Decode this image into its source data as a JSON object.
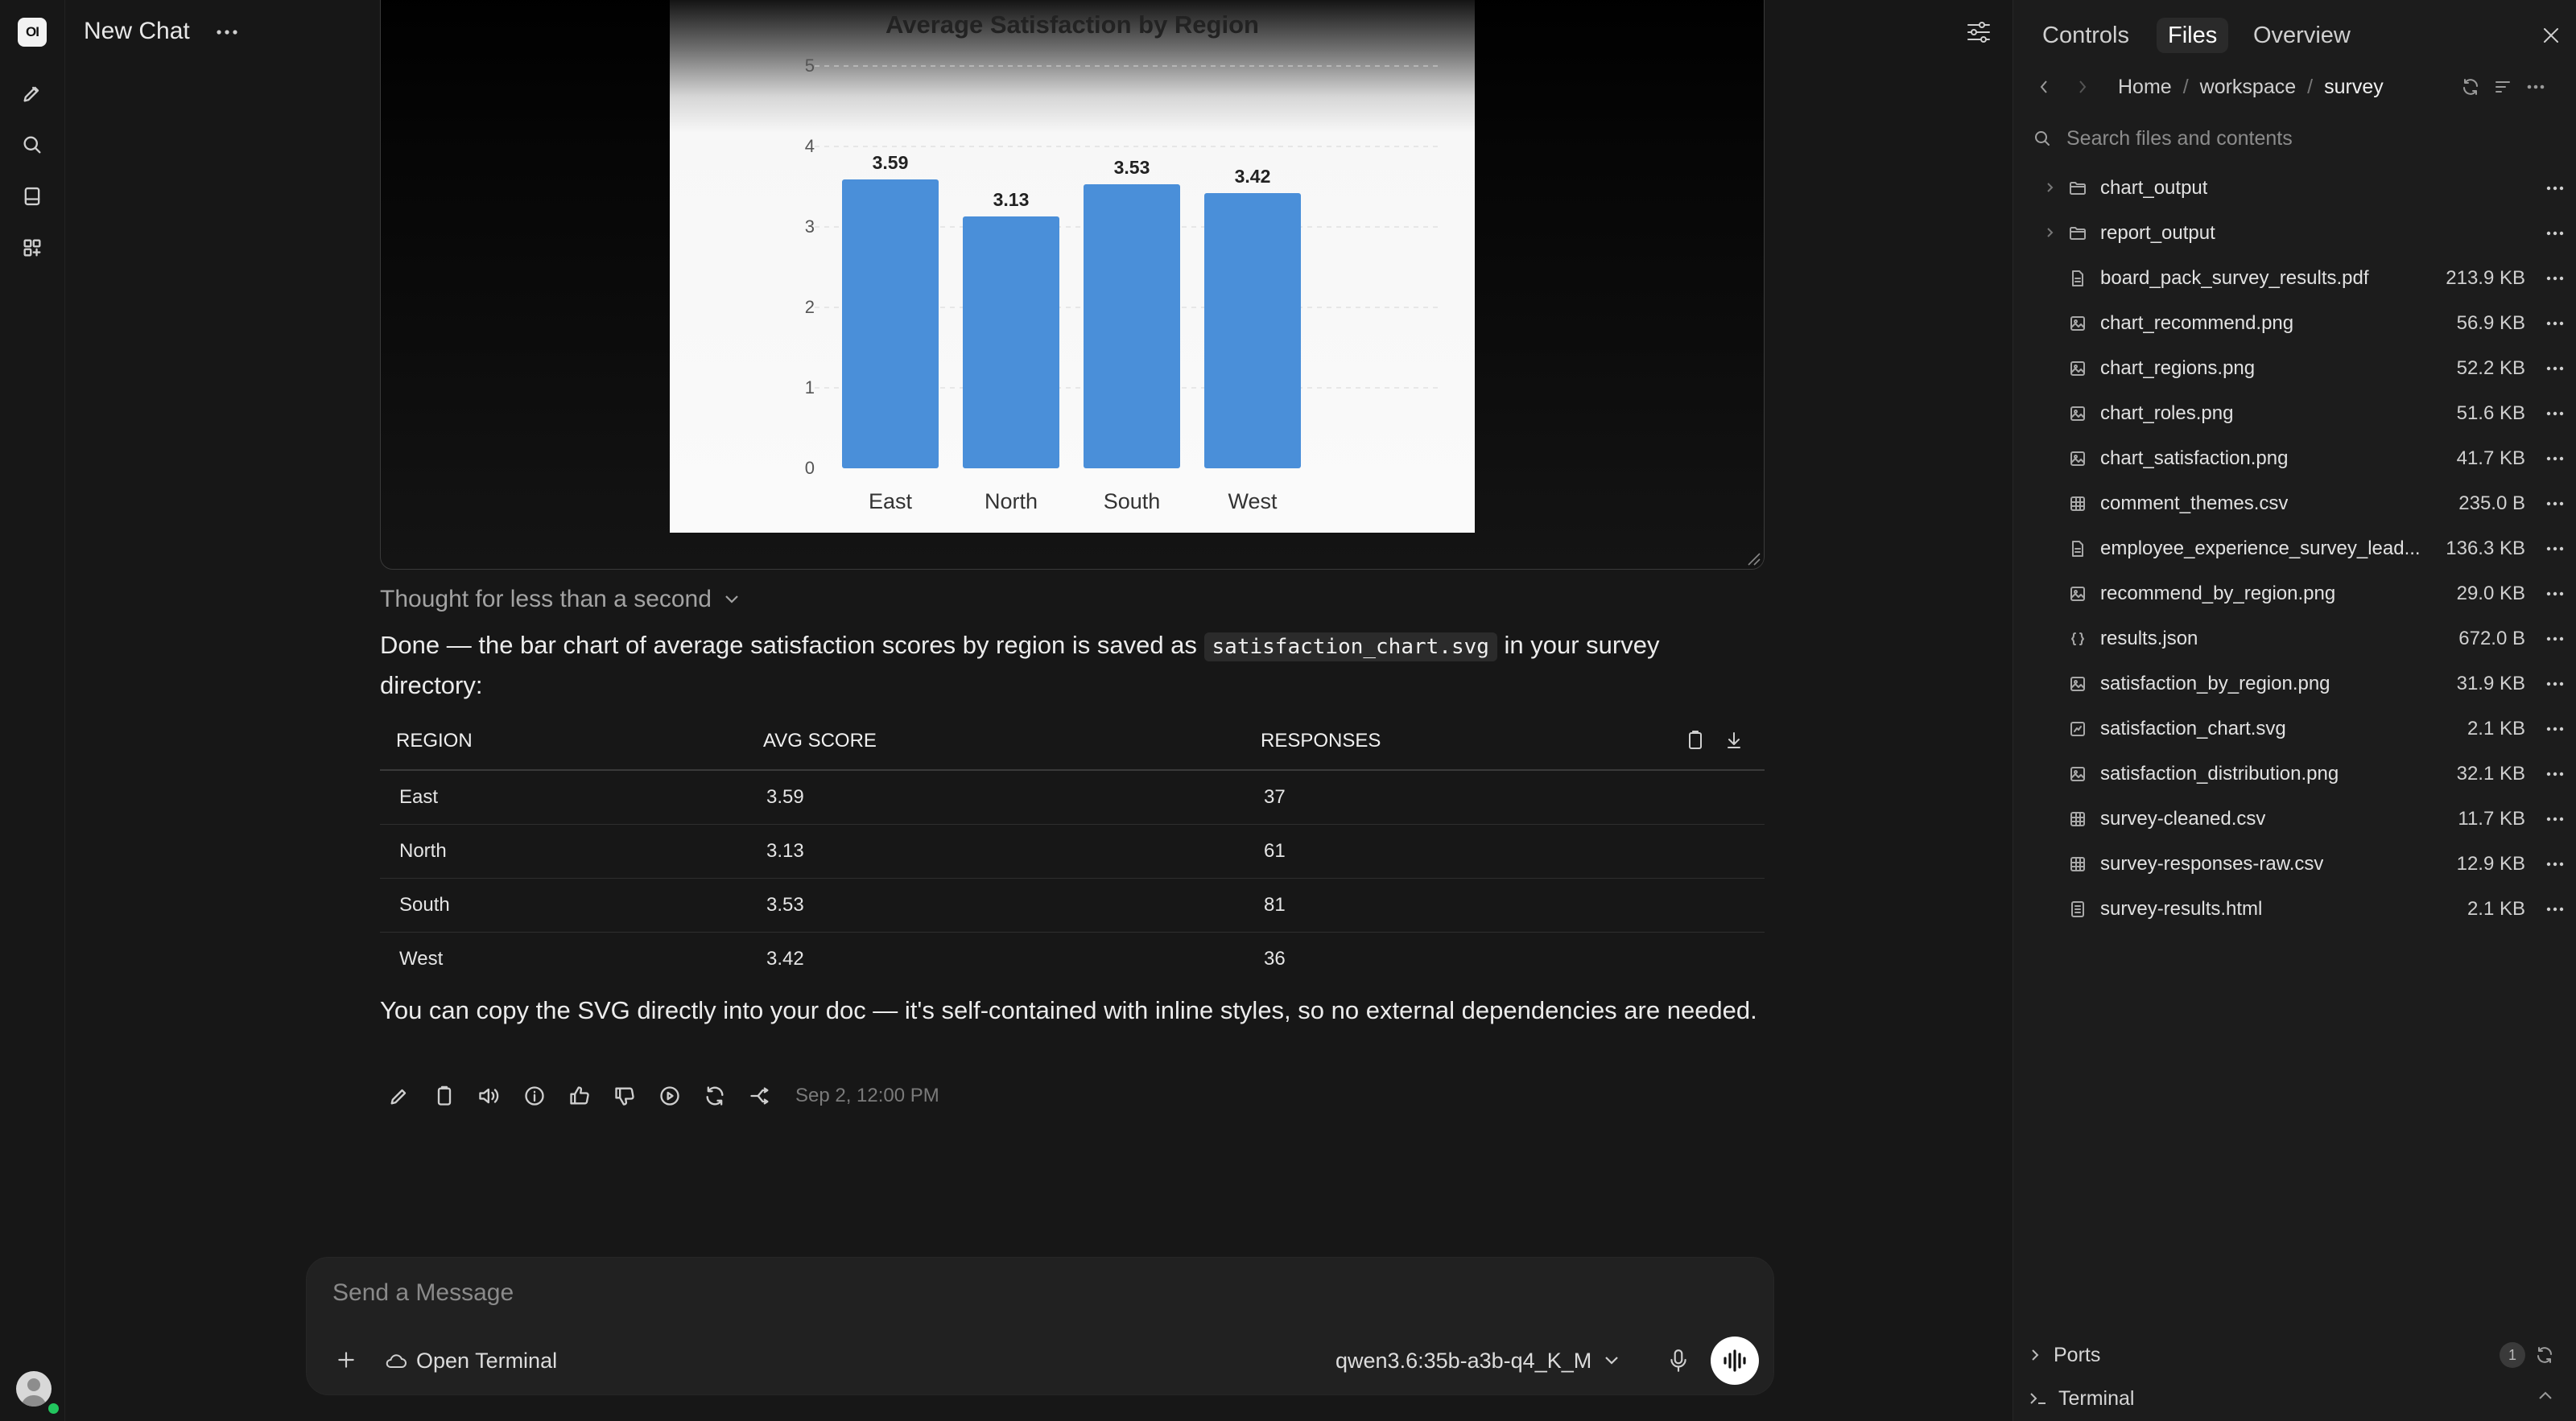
{
  "header": {
    "chat_title": "New Chat"
  },
  "chart_data": {
    "type": "bar",
    "title": "Average Satisfaction by Region",
    "categories": [
      "East",
      "North",
      "South",
      "West"
    ],
    "values": [
      3.59,
      3.13,
      3.53,
      3.42
    ],
    "value_labels": [
      "3.59",
      "3.13",
      "3.53",
      "3.42"
    ],
    "ylim": [
      0,
      5
    ],
    "yticks": [
      0,
      1,
      2,
      3,
      4,
      5
    ],
    "bar_color": "#4a8fd9",
    "grid": true
  },
  "message": {
    "thought": "Thought for less than a second",
    "intro_before": "Done — the bar chart of average satisfaction scores by region is saved as ",
    "intro_code": "satisfaction_chart.svg",
    "intro_after": " in your survey directory:",
    "table": {
      "headers": [
        "REGION",
        "AVG SCORE",
        "RESPONSES"
      ],
      "rows": [
        [
          "East",
          "3.59",
          "37"
        ],
        [
          "North",
          "3.13",
          "61"
        ],
        [
          "South",
          "3.53",
          "81"
        ],
        [
          "West",
          "3.42",
          "36"
        ]
      ]
    },
    "outro": "You can copy the SVG directly into your doc — it's self-contained with inline styles, so no external dependencies are needed.",
    "timestamp": "Sep 2, 12:00 PM"
  },
  "composer": {
    "placeholder": "Send a Message",
    "terminal_label": "Open Terminal",
    "model": "qwen3.6:35b-a3b-q4_K_M"
  },
  "panel": {
    "tabs": [
      "Controls",
      "Files",
      "Overview"
    ],
    "active_tab": "Files",
    "breadcrumb": [
      "Home",
      "workspace",
      "survey"
    ],
    "search_placeholder": "Search files and contents",
    "files": [
      {
        "name": "chart_output",
        "size": "",
        "kind": "folder"
      },
      {
        "name": "report_output",
        "size": "",
        "kind": "folder"
      },
      {
        "name": "board_pack_survey_results.pdf",
        "size": "213.9 KB",
        "kind": "doc"
      },
      {
        "name": "chart_recommend.png",
        "size": "56.9 KB",
        "kind": "image"
      },
      {
        "name": "chart_regions.png",
        "size": "52.2 KB",
        "kind": "image"
      },
      {
        "name": "chart_roles.png",
        "size": "51.6 KB",
        "kind": "image"
      },
      {
        "name": "chart_satisfaction.png",
        "size": "41.7 KB",
        "kind": "image"
      },
      {
        "name": "comment_themes.csv",
        "size": "235.0 B",
        "kind": "table"
      },
      {
        "name": "employee_experience_survey_lead...",
        "size": "136.3 KB",
        "kind": "doc"
      },
      {
        "name": "recommend_by_region.png",
        "size": "29.0 KB",
        "kind": "image"
      },
      {
        "name": "results.json",
        "size": "672.0 B",
        "kind": "json"
      },
      {
        "name": "satisfaction_by_region.png",
        "size": "31.9 KB",
        "kind": "image"
      },
      {
        "name": "satisfaction_chart.svg",
        "size": "2.1 KB",
        "kind": "svg"
      },
      {
        "name": "satisfaction_distribution.png",
        "size": "32.1 KB",
        "kind": "image"
      },
      {
        "name": "survey-cleaned.csv",
        "size": "11.7 KB",
        "kind": "table"
      },
      {
        "name": "survey-responses-raw.csv",
        "size": "12.9 KB",
        "kind": "table"
      },
      {
        "name": "survey-results.html",
        "size": "2.1 KB",
        "kind": "html"
      }
    ],
    "ports_label": "Ports",
    "ports_count": "1",
    "terminal_label": "Terminal"
  }
}
